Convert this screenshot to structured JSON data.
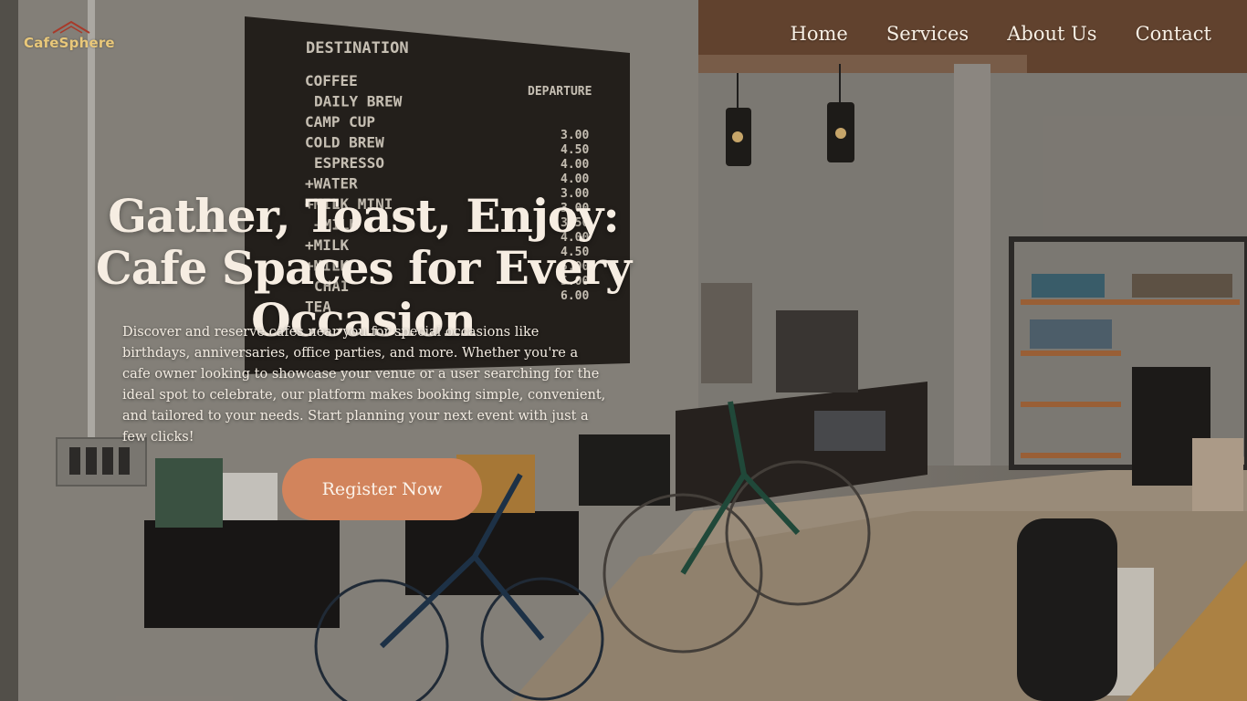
{
  "brand": {
    "logo_text": "CafeSphere",
    "logo_color": "#e9c87a"
  },
  "nav": {
    "items": [
      {
        "label": "Home"
      },
      {
        "label": "Services"
      },
      {
        "label": "About Us"
      },
      {
        "label": "Contact"
      }
    ]
  },
  "hero": {
    "headline_line1": "Gather, Toast, Enjoy:",
    "headline_line2": "Cafe Spaces for Every Occasion",
    "description": "Discover and reserve cafes near you for special occasions like birthdays, anniversaries, office parties, and more. Whether you're a cafe owner looking to showcase your venue or a user searching for the ideal spot to celebrate, our platform makes booking simple, convenient, and tailored to your needs. Start planning your next event with just a few clicks!",
    "cta_label": "Register Now",
    "cta_color": "#d2845c"
  },
  "background": {
    "menu_board": {
      "title": "DESTINATION",
      "column_header": "DEPARTURE",
      "items": [
        "COFFEE",
        "DAILY BREW",
        "CAMP CUP",
        "COLD BREW",
        "ESPRESSO",
        "+WATER",
        "+MILK MINI",
        "+MILK",
        "+MILK",
        "+MILK",
        "CHAI",
        "TEA"
      ],
      "prices": [
        "3.00",
        "4.50",
        "4.00",
        "4.00",
        "3.00",
        "3.00",
        "3.50",
        "4.00",
        "4.50",
        "5.00",
        "5.00",
        "6.00"
      ]
    }
  }
}
